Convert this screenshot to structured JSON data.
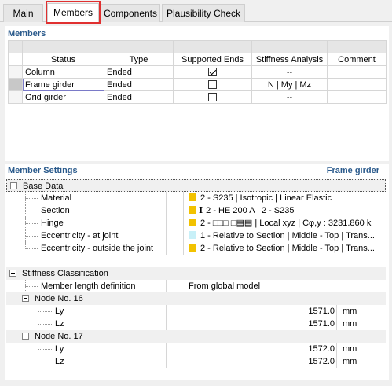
{
  "tabs": [
    {
      "label": "Main"
    },
    {
      "label": "Members"
    },
    {
      "label": "Components"
    },
    {
      "label": "Plausibility Check"
    }
  ],
  "members": {
    "title": "Members",
    "columns": [
      "Status",
      "Type",
      "Supported Ends",
      "Stiffness Analysis",
      "Comment"
    ],
    "rows": [
      {
        "status": "Column",
        "type": "Ended",
        "supported": true,
        "stiffness": "--",
        "comment": ""
      },
      {
        "status": "Frame girder",
        "type": "Ended",
        "supported": false,
        "stiffness": "N | My | Mz",
        "comment": ""
      },
      {
        "status": "Grid girder",
        "type": "Ended",
        "supported": false,
        "stiffness": "--",
        "comment": ""
      }
    ]
  },
  "settings": {
    "title": "Member Settings",
    "context": "Frame girder",
    "base_data": {
      "label": "Base Data",
      "items": [
        {
          "label": "Material",
          "value": "2 - S235 | Isotropic | Linear Elastic",
          "color": "#f2c200"
        },
        {
          "label": "Section",
          "value": "2 - HE 200 A | 2 - S235",
          "color": "#f2c200",
          "glyph": "I"
        },
        {
          "label": "Hinge",
          "value": "2 - □□□ □▤▤ | Local xyz | Cφ,y : 3231.860 k",
          "color": "#f2c200"
        },
        {
          "label": "Eccentricity - at joint",
          "value": "1 - Relative to Section | Middle - Top | Trans...",
          "color": "#c8f0f8"
        },
        {
          "label": "Eccentricity - outside the joint",
          "value": "2 - Relative to Section | Middle - Top | Trans...",
          "color": "#f2c200"
        }
      ]
    },
    "stiffness": {
      "label": "Stiffness Classification",
      "length_def_label": "Member length definition",
      "length_def_value": "From global model",
      "nodes": [
        {
          "label": "Node No. 16",
          "ly": "1571.0",
          "lz": "1571.0"
        },
        {
          "label": "Node No. 17",
          "ly": "1572.0",
          "lz": "1572.0"
        }
      ],
      "ly_label": "Ly",
      "lz_label": "Lz",
      "unit": "mm"
    }
  }
}
